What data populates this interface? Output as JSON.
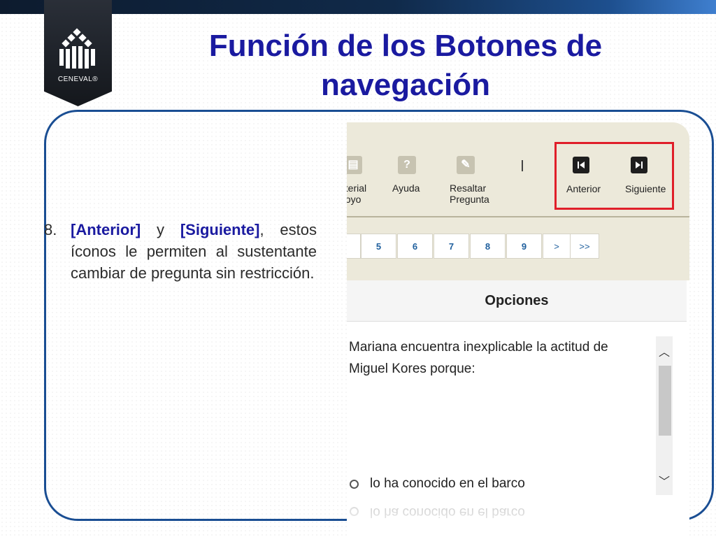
{
  "logo": {
    "text": "CENEVAL®"
  },
  "title": "Función de los Botones de navegación",
  "bullet": {
    "number": "8.",
    "kw1": "[Anterior]",
    "connector": " y ",
    "kw2": "[Siguiente]",
    "rest": ", estos íconos le permiten al sustentante cambiar de pregunta sin restricción."
  },
  "toolbar": {
    "material_label": "aterial\npoyo",
    "ayuda_label": "Ayuda",
    "resaltar_label": "Resaltar\nPregunta",
    "separator": "|",
    "anterior_label": "Anterior",
    "siguiente_label": "Siguiente"
  },
  "pager": {
    "pages": [
      "5",
      "6",
      "7",
      "8",
      "9"
    ],
    "next": ">",
    "last": ">>"
  },
  "options_header": "Opciones",
  "question": "Mariana encuentra inexplicable la actitud de Miguel Kores porque:",
  "option_1": "lo ha conocido en el barco",
  "colors": {
    "title": "#1a1aa0",
    "frame": "#1a4e93",
    "highlight": "#e01f2a"
  },
  "icons": [
    "material-icon",
    "help-icon",
    "highlight-icon",
    "previous-icon",
    "next-icon",
    "chevron-up-icon",
    "chevron-down-icon"
  ]
}
